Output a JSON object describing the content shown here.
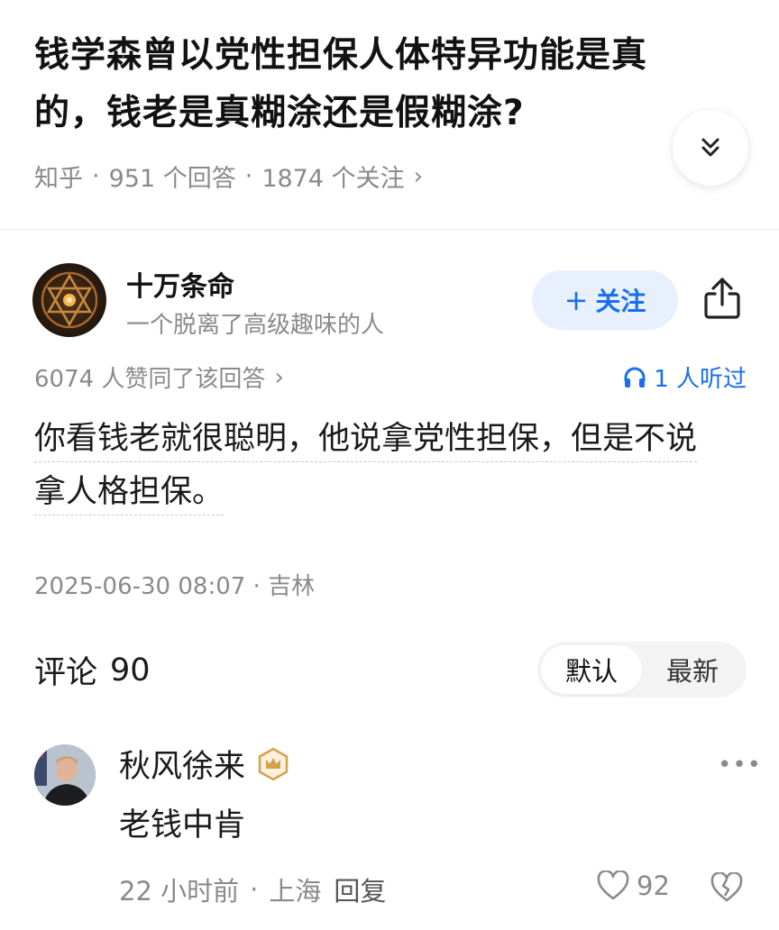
{
  "question": {
    "title": "钱学森曾以党性担保人体特异功能是真的，钱老是真糊涂还是假糊涂?",
    "source": "知乎",
    "answers_count": "951 个回答",
    "followers_count": "1874 个关注"
  },
  "answer": {
    "author_name": "十万条命",
    "author_bio": "一个脱离了高级趣味的人",
    "follow_label": "关注",
    "upvote_text": "6074 人赞同了该回答",
    "listen_text": "1 人听过",
    "body_line1": "你看钱老就很聪明，他说拿党性担保，但是不说",
    "body_line2": "拿人格担保。",
    "timestamp": "2025-06-30 08:07 · 吉林"
  },
  "comments": {
    "header_label": "评论",
    "header_count": "90",
    "sort_options": [
      "默认",
      "最新"
    ],
    "sort_selected": "默认",
    "items": [
      {
        "user": "秋风徐来",
        "text": "老钱中肯",
        "time": "22 小时前",
        "location": "上海",
        "reply_label": "回复",
        "likes": "92"
      }
    ]
  },
  "icons": {
    "collapse": "double-chevron-down-icon",
    "share": "share-icon",
    "headphones": "headphones-icon",
    "badge": "crown-badge-icon",
    "more": "more-icon",
    "like": "heart-icon",
    "dislike": "broken-heart-icon"
  },
  "colors": {
    "accent": "#1a6ef0",
    "follow_bg": "#e8f0fd",
    "muted_text": "#8a8a8a",
    "badge_gold": "#d4a24a"
  }
}
